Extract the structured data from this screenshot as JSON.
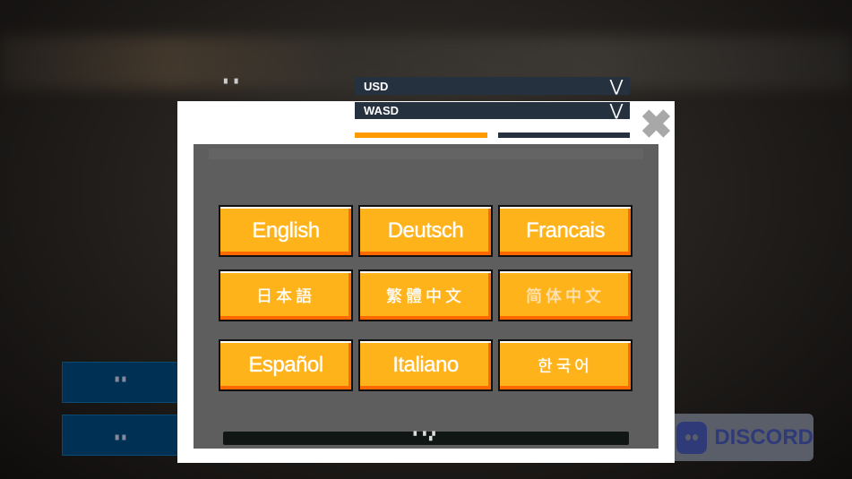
{
  "settings": {
    "top_label": "▘▝",
    "currency": "USD",
    "controls": "WASD"
  },
  "side_buttons": [
    {
      "label": "▘▘"
    },
    {
      "label": "▖▖"
    }
  ],
  "discord": {
    "label": "DISCORD"
  },
  "language_dialog": {
    "languages": [
      "English",
      "Deutsch",
      "Francais",
      "日本語",
      "繁體中文",
      "简体中文",
      "Español",
      "Italiano",
      "한국어"
    ],
    "footer": "▘▝▗▘"
  },
  "colors": {
    "button": "#ffb31a",
    "button_shadow": "#ff6a00",
    "dropdown": "#263140",
    "tab_active": "#ff9a00",
    "panel": "#5e5e5e"
  }
}
